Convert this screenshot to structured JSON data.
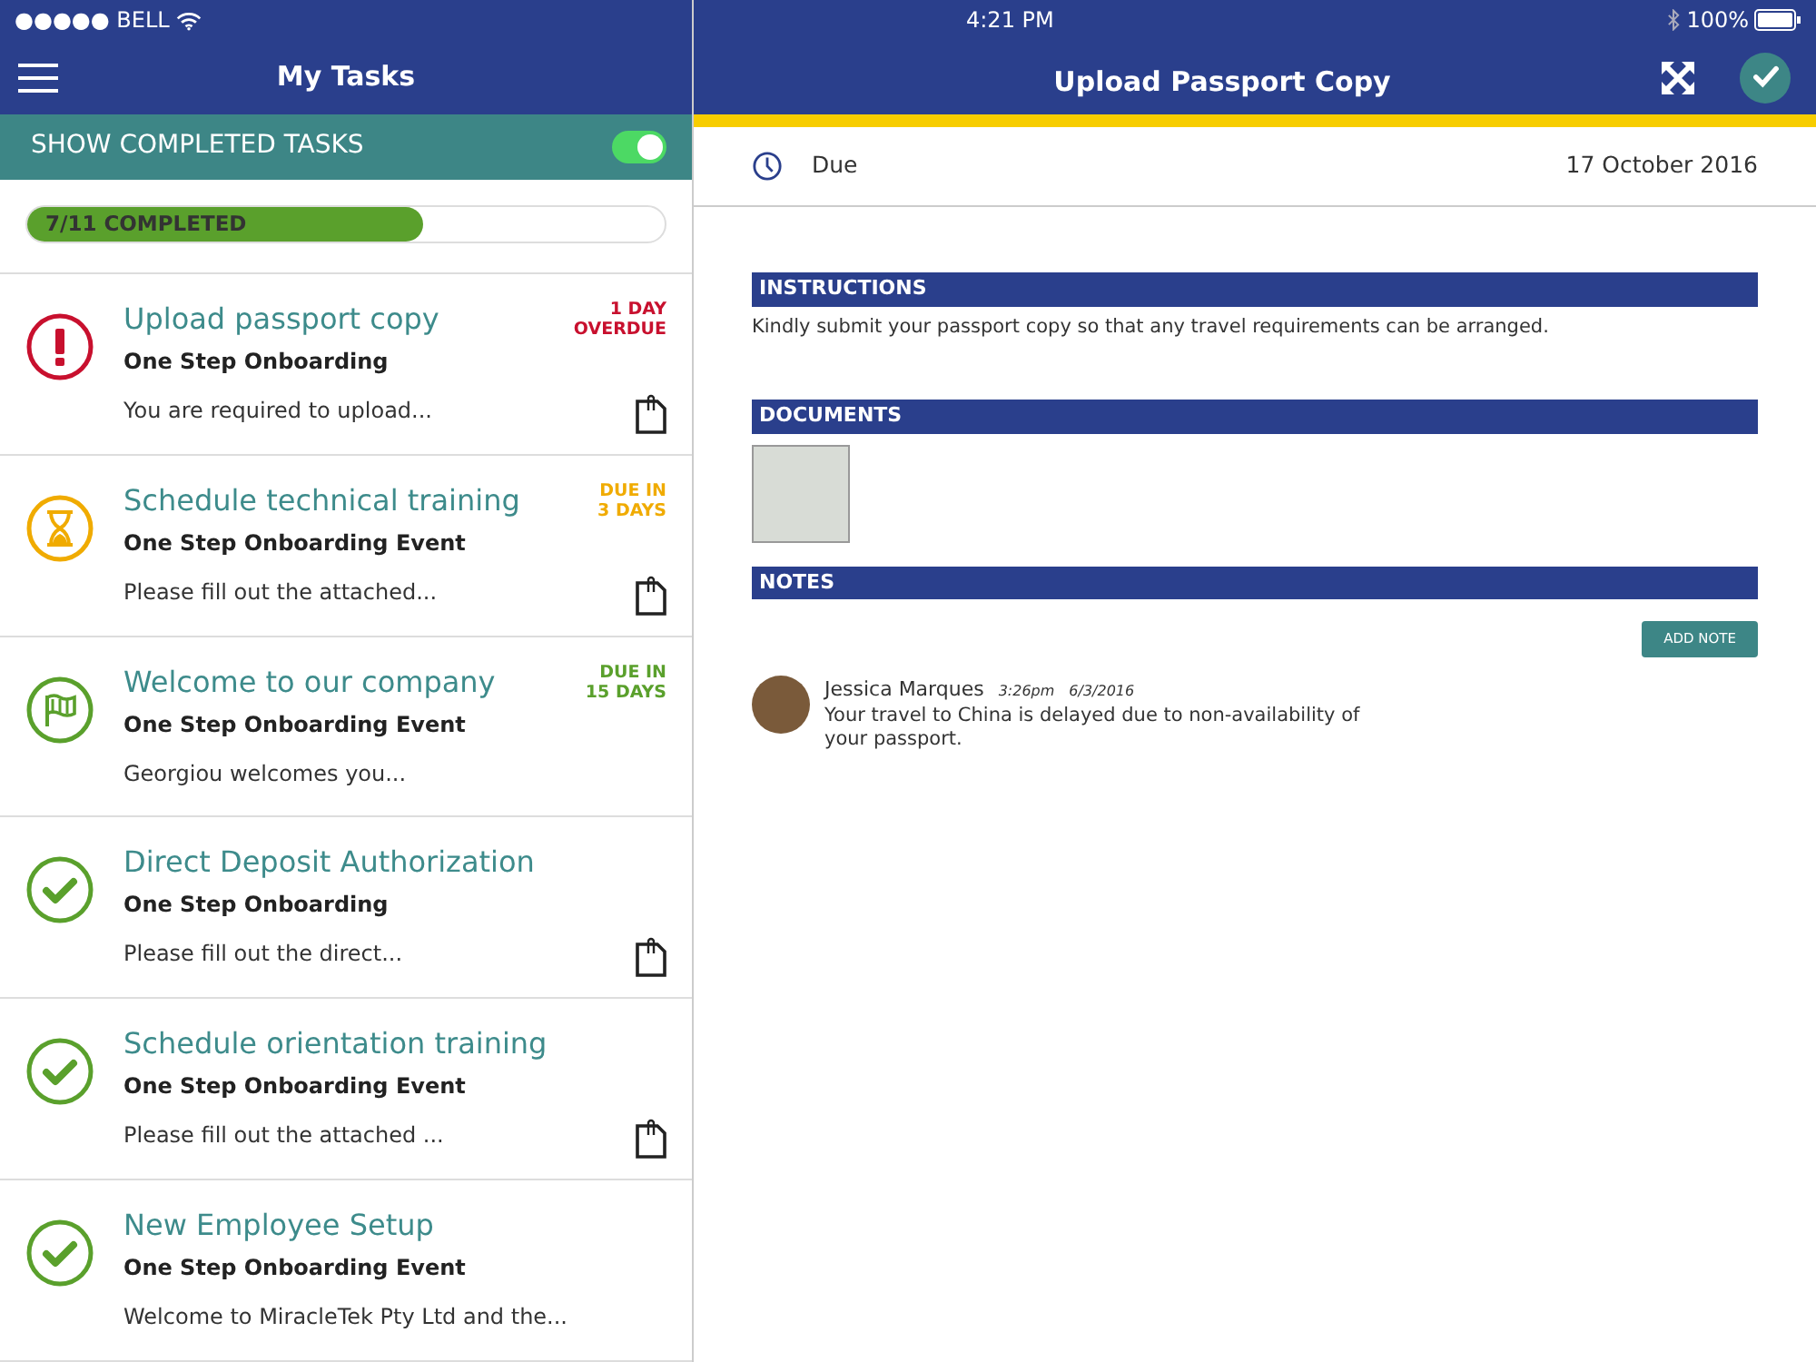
{
  "status_bar": {
    "carrier": "●●●●● BELL",
    "time": "4:21 PM",
    "battery": "100%"
  },
  "sidebar": {
    "title": "My Tasks",
    "show_completed": {
      "label": "SHOW COMPLETED TASKS",
      "on": true
    },
    "progress": {
      "label": "7/11 COMPLETED",
      "level": 0.62
    },
    "tasks": [
      {
        "kind": "overdue",
        "color": "#c8102e",
        "title": "Upload passport copy",
        "source": "One Step Onboarding",
        "summary": "You are required to upload...",
        "due": [
          "1 DAY",
          "OVERDUE"
        ],
        "attachment": true
      },
      {
        "kind": "pending",
        "color": "#f0ab00",
        "title": "Schedule technical training",
        "source": "One Step Onboarding Event",
        "summary": "Please fill out the attached...",
        "due": [
          "DUE IN",
          "3 DAYS"
        ],
        "attachment": true
      },
      {
        "kind": "welcome",
        "color": "#5aa02c",
        "title": "Welcome to our company",
        "source": "One Step Onboarding Event",
        "summary": "Georgiou welcomes you...",
        "due": [
          "DUE IN",
          "15 DAYS"
        ],
        "attachment": false
      },
      {
        "kind": "done",
        "color": "#5aa02c",
        "title": "Direct Deposit Authorization",
        "source": "One Step Onboarding",
        "summary": "Please fill out the direct...",
        "attachment": true
      },
      {
        "kind": "done",
        "color": "#5aa02c",
        "title": "Schedule orientation training",
        "source": "One Step Onboarding Event",
        "summary": "Please fill out the attached ...",
        "attachment": true
      },
      {
        "kind": "done",
        "color": "#5aa02c",
        "title": "New Employee Setup",
        "source": "One Step Onboarding Event",
        "summary": "Welcome to MiracleTek Pty Ltd and the...",
        "attachment": false
      }
    ]
  },
  "detail": {
    "title": "Upload Passport Copy",
    "due_label": "Due",
    "due_date": "17 October 2016",
    "instructions": {
      "heading": "INSTRUCTIONS",
      "text": "Kindly submit your passport copy so that any travel requirements can be arranged."
    },
    "documents": {
      "heading": "DOCUMENTS"
    },
    "notes": {
      "heading": "NOTES",
      "add_button": "ADD NOTE",
      "items": [
        {
          "author": "Jessica Marques",
          "time": "3:26pm",
          "date": "6/3/2016",
          "text": "Your travel to China is delayed due to non-availability of your passport."
        }
      ]
    }
  }
}
